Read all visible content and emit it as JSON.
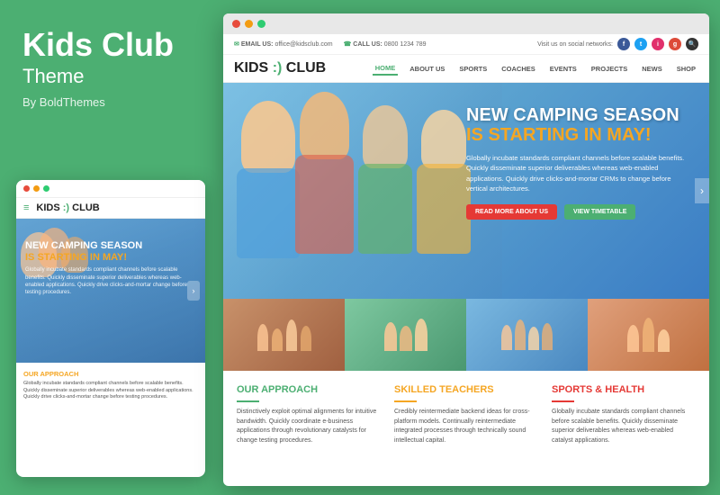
{
  "left": {
    "title": "Kids Club",
    "subtitle": "Theme",
    "author": "By BoldThemes"
  },
  "mobile": {
    "dots": [
      "#e74c3c",
      "#f39c12",
      "#2ecc71"
    ],
    "logo": "KIDS :) CLUB",
    "hero": {
      "title": "NEW CAMPING SEASON",
      "highlight": "IS STARTING IN MAY!",
      "desc": "Globally incubate standards compliant channels before scalable benefits. Quickly disseminate superior deliverables whereas web-enabled applications. Quickly drive clicks-and-mortar change before testing procedures."
    }
  },
  "browser": {
    "dots": [
      "#e74c3c",
      "#f39c12",
      "#2ecc71"
    ],
    "topbar": {
      "email_label": "EMAIL US:",
      "email_value": "office@kidsclub.com",
      "phone_label": "CALL US:",
      "phone_value": "0800 1234 789",
      "social_label": "Visit us on social networks:"
    },
    "nav": {
      "logo": "KIDS :) CLUB",
      "items": [
        "HOME",
        "ABOUT US",
        "SPORTS",
        "COACHES",
        "EVENTS",
        "PROJECTS",
        "NEWS",
        "SHOP"
      ]
    },
    "hero": {
      "title": "NEW CAMPING SEASON",
      "highlight": "IS STARTING IN MAY!",
      "desc": "Globally incubate standards compliant channels before scalable benefits. Quickly disseminate superior deliverables whereas web-enabled applications. Quickly drive clicks-and-mortar CRMs to change before vertical architectures.",
      "btn1": "READ MORE ABOUT US",
      "btn2": "VIEW TIMETABLE"
    },
    "sections": [
      {
        "title": "OUR APPROACH",
        "color": "green",
        "text": "Distinctively exploit optimal alignments for intuitive bandwidth. Quickly coordinate e-business applications through revolutionary catalysts for change testing procedures."
      },
      {
        "title": "SKILLED TEACHERS",
        "color": "orange",
        "text": "Credibly reintermediate backend ideas for cross-platform models. Continually reintermediate integrated processes through technically sound intellectual capital."
      },
      {
        "title": "SPORTS & HEALTH",
        "color": "red",
        "text": "Globally incubate standards compliant channels before scalable benefits. Quickly disseminate superior deliverables whereas web-enabled catalyst applications."
      }
    ]
  },
  "colors": {
    "green": "#4caf72",
    "orange": "#f5a623",
    "red": "#e53935",
    "bg": "#4caf72"
  }
}
